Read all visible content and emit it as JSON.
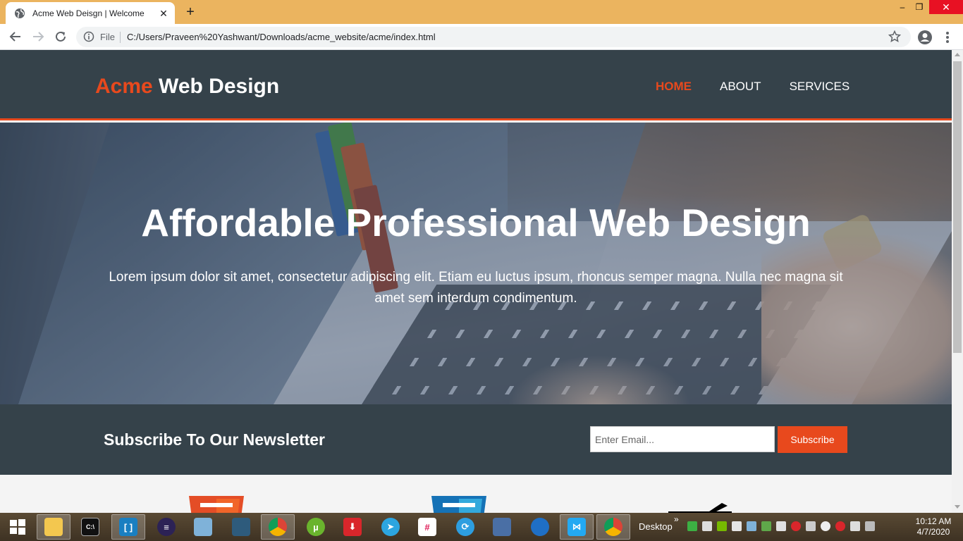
{
  "browser": {
    "tab_title": "Acme Web Deisgn | Welcome",
    "new_tab": "+",
    "close_tab": "✕",
    "file_label": "File",
    "url": "C:/Users/Praveen%20Yashwant/Downloads/acme_website/acme/index.html",
    "window_min": "–",
    "window_max": "❐",
    "window_close": "✕"
  },
  "site": {
    "brand_highlight": "Acme",
    "brand_rest": " Web Design",
    "nav": [
      {
        "label": "HOME",
        "current": true
      },
      {
        "label": "ABOUT",
        "current": false
      },
      {
        "label": "SERVICES",
        "current": false
      }
    ],
    "showcase": {
      "title": "Affordable Professional Web Design",
      "text": "Lorem ipsum dolor sit amet, consectetur adipiscing elit. Etiam eu luctus ipsum, rhoncus semper magna. Nulla nec magna sit amet sem interdum condimentum."
    },
    "newsletter": {
      "title": "Subscribe To Our Newsletter",
      "email_placeholder": "Enter Email...",
      "button": "Subscribe"
    },
    "colors": {
      "accent": "#e8491d",
      "header_bg": "#35424a"
    }
  },
  "taskbar": {
    "desktop_label": "Desktop",
    "chevron": "»",
    "time": "10:12 AM",
    "date": "4/7/2020",
    "apps": [
      "file-explorer",
      "command-prompt",
      "brackets",
      "eclipse",
      "notepad",
      "mysql-workbench",
      "chrome",
      "utorrent",
      "downloader",
      "telegram",
      "slack",
      "sync",
      "remote-desktop",
      "thunderbird",
      "visual-studio-code",
      "chrome-active"
    ]
  }
}
